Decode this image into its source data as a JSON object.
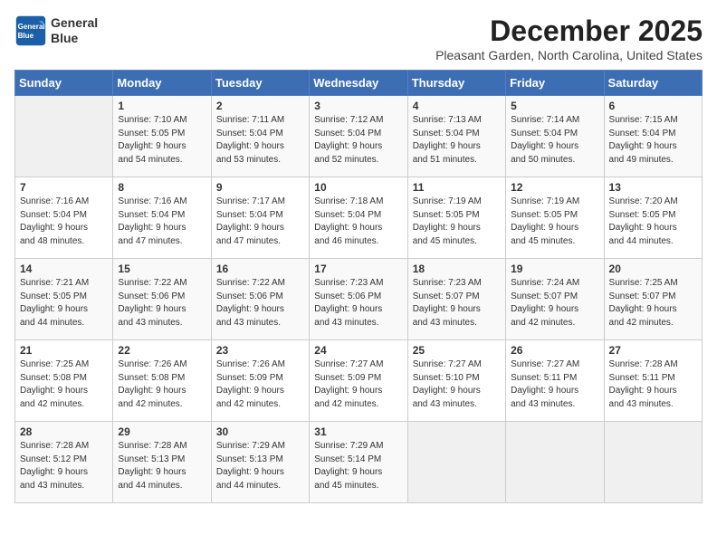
{
  "header": {
    "logo_line1": "General",
    "logo_line2": "Blue",
    "month": "December 2025",
    "location": "Pleasant Garden, North Carolina, United States"
  },
  "days_of_week": [
    "Sunday",
    "Monday",
    "Tuesday",
    "Wednesday",
    "Thursday",
    "Friday",
    "Saturday"
  ],
  "weeks": [
    [
      {
        "day": "",
        "info": ""
      },
      {
        "day": "1",
        "info": "Sunrise: 7:10 AM\nSunset: 5:05 PM\nDaylight: 9 hours\nand 54 minutes."
      },
      {
        "day": "2",
        "info": "Sunrise: 7:11 AM\nSunset: 5:04 PM\nDaylight: 9 hours\nand 53 minutes."
      },
      {
        "day": "3",
        "info": "Sunrise: 7:12 AM\nSunset: 5:04 PM\nDaylight: 9 hours\nand 52 minutes."
      },
      {
        "day": "4",
        "info": "Sunrise: 7:13 AM\nSunset: 5:04 PM\nDaylight: 9 hours\nand 51 minutes."
      },
      {
        "day": "5",
        "info": "Sunrise: 7:14 AM\nSunset: 5:04 PM\nDaylight: 9 hours\nand 50 minutes."
      },
      {
        "day": "6",
        "info": "Sunrise: 7:15 AM\nSunset: 5:04 PM\nDaylight: 9 hours\nand 49 minutes."
      }
    ],
    [
      {
        "day": "7",
        "info": "Sunrise: 7:16 AM\nSunset: 5:04 PM\nDaylight: 9 hours\nand 48 minutes."
      },
      {
        "day": "8",
        "info": "Sunrise: 7:16 AM\nSunset: 5:04 PM\nDaylight: 9 hours\nand 47 minutes."
      },
      {
        "day": "9",
        "info": "Sunrise: 7:17 AM\nSunset: 5:04 PM\nDaylight: 9 hours\nand 47 minutes."
      },
      {
        "day": "10",
        "info": "Sunrise: 7:18 AM\nSunset: 5:04 PM\nDaylight: 9 hours\nand 46 minutes."
      },
      {
        "day": "11",
        "info": "Sunrise: 7:19 AM\nSunset: 5:05 PM\nDaylight: 9 hours\nand 45 minutes."
      },
      {
        "day": "12",
        "info": "Sunrise: 7:19 AM\nSunset: 5:05 PM\nDaylight: 9 hours\nand 45 minutes."
      },
      {
        "day": "13",
        "info": "Sunrise: 7:20 AM\nSunset: 5:05 PM\nDaylight: 9 hours\nand 44 minutes."
      }
    ],
    [
      {
        "day": "14",
        "info": "Sunrise: 7:21 AM\nSunset: 5:05 PM\nDaylight: 9 hours\nand 44 minutes."
      },
      {
        "day": "15",
        "info": "Sunrise: 7:22 AM\nSunset: 5:06 PM\nDaylight: 9 hours\nand 43 minutes."
      },
      {
        "day": "16",
        "info": "Sunrise: 7:22 AM\nSunset: 5:06 PM\nDaylight: 9 hours\nand 43 minutes."
      },
      {
        "day": "17",
        "info": "Sunrise: 7:23 AM\nSunset: 5:06 PM\nDaylight: 9 hours\nand 43 minutes."
      },
      {
        "day": "18",
        "info": "Sunrise: 7:23 AM\nSunset: 5:07 PM\nDaylight: 9 hours\nand 43 minutes."
      },
      {
        "day": "19",
        "info": "Sunrise: 7:24 AM\nSunset: 5:07 PM\nDaylight: 9 hours\nand 42 minutes."
      },
      {
        "day": "20",
        "info": "Sunrise: 7:25 AM\nSunset: 5:07 PM\nDaylight: 9 hours\nand 42 minutes."
      }
    ],
    [
      {
        "day": "21",
        "info": "Sunrise: 7:25 AM\nSunset: 5:08 PM\nDaylight: 9 hours\nand 42 minutes."
      },
      {
        "day": "22",
        "info": "Sunrise: 7:26 AM\nSunset: 5:08 PM\nDaylight: 9 hours\nand 42 minutes."
      },
      {
        "day": "23",
        "info": "Sunrise: 7:26 AM\nSunset: 5:09 PM\nDaylight: 9 hours\nand 42 minutes."
      },
      {
        "day": "24",
        "info": "Sunrise: 7:27 AM\nSunset: 5:09 PM\nDaylight: 9 hours\nand 42 minutes."
      },
      {
        "day": "25",
        "info": "Sunrise: 7:27 AM\nSunset: 5:10 PM\nDaylight: 9 hours\nand 43 minutes."
      },
      {
        "day": "26",
        "info": "Sunrise: 7:27 AM\nSunset: 5:11 PM\nDaylight: 9 hours\nand 43 minutes."
      },
      {
        "day": "27",
        "info": "Sunrise: 7:28 AM\nSunset: 5:11 PM\nDaylight: 9 hours\nand 43 minutes."
      }
    ],
    [
      {
        "day": "28",
        "info": "Sunrise: 7:28 AM\nSunset: 5:12 PM\nDaylight: 9 hours\nand 43 minutes."
      },
      {
        "day": "29",
        "info": "Sunrise: 7:28 AM\nSunset: 5:13 PM\nDaylight: 9 hours\nand 44 minutes."
      },
      {
        "day": "30",
        "info": "Sunrise: 7:29 AM\nSunset: 5:13 PM\nDaylight: 9 hours\nand 44 minutes."
      },
      {
        "day": "31",
        "info": "Sunrise: 7:29 AM\nSunset: 5:14 PM\nDaylight: 9 hours\nand 45 minutes."
      },
      {
        "day": "",
        "info": ""
      },
      {
        "day": "",
        "info": ""
      },
      {
        "day": "",
        "info": ""
      }
    ]
  ]
}
